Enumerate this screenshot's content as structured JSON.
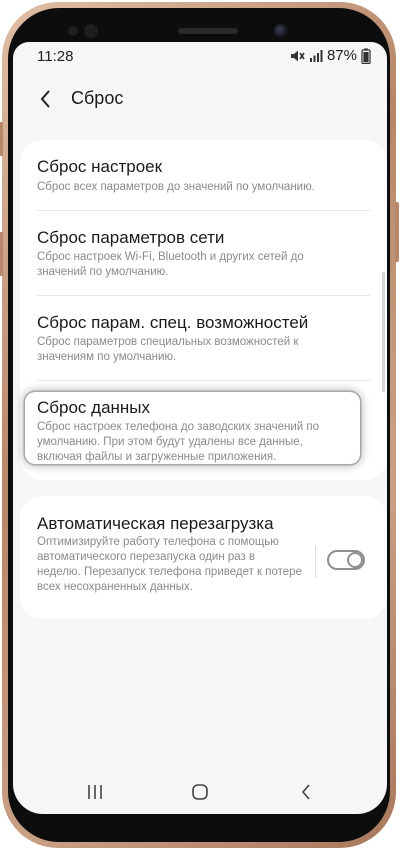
{
  "status_bar": {
    "time": "11:28",
    "battery": "87%",
    "icons": [
      "mute-icon",
      "signal-icon",
      "battery-icon"
    ]
  },
  "header": {
    "title": "Сброс",
    "back_icon": "back-arrow-icon"
  },
  "reset_items": [
    {
      "title": "Сброс настроек",
      "description": "Сброс всех параметров до значений по умолчанию."
    },
    {
      "title": "Сброс параметров сети",
      "description": "Сброс настроек Wi-Fi, Bluetooth и других сетей до значений по умолчанию."
    },
    {
      "title": "Сброс парам. спец. возможностей",
      "description": "Сброс параметров специальных возможностей к значениям по умолчанию."
    },
    {
      "title": "Сброс данных",
      "description": "Сброс настроек телефона до заводских значений по умолчанию. При этом будут удалены все данные, включая файлы и загруженные приложения."
    }
  ],
  "auto_restart": {
    "title": "Автоматическая перезагрузка",
    "description": "Оптимизируйте работу телефона с помощью автоматического перезапуска один раз в неделю. Перезапуск телефона приведет к потере всех несохраненных данных.",
    "enabled": false
  },
  "navigation_bar": {
    "icons": [
      "recent-apps-icon",
      "home-icon",
      "back-icon"
    ]
  },
  "colors": {
    "screen_background": "#f6f6f6",
    "card_background": "#ffffff",
    "title_text": "#1a1a1a",
    "secondary_text": "#8a8a8a",
    "frame": "#b7876a"
  }
}
